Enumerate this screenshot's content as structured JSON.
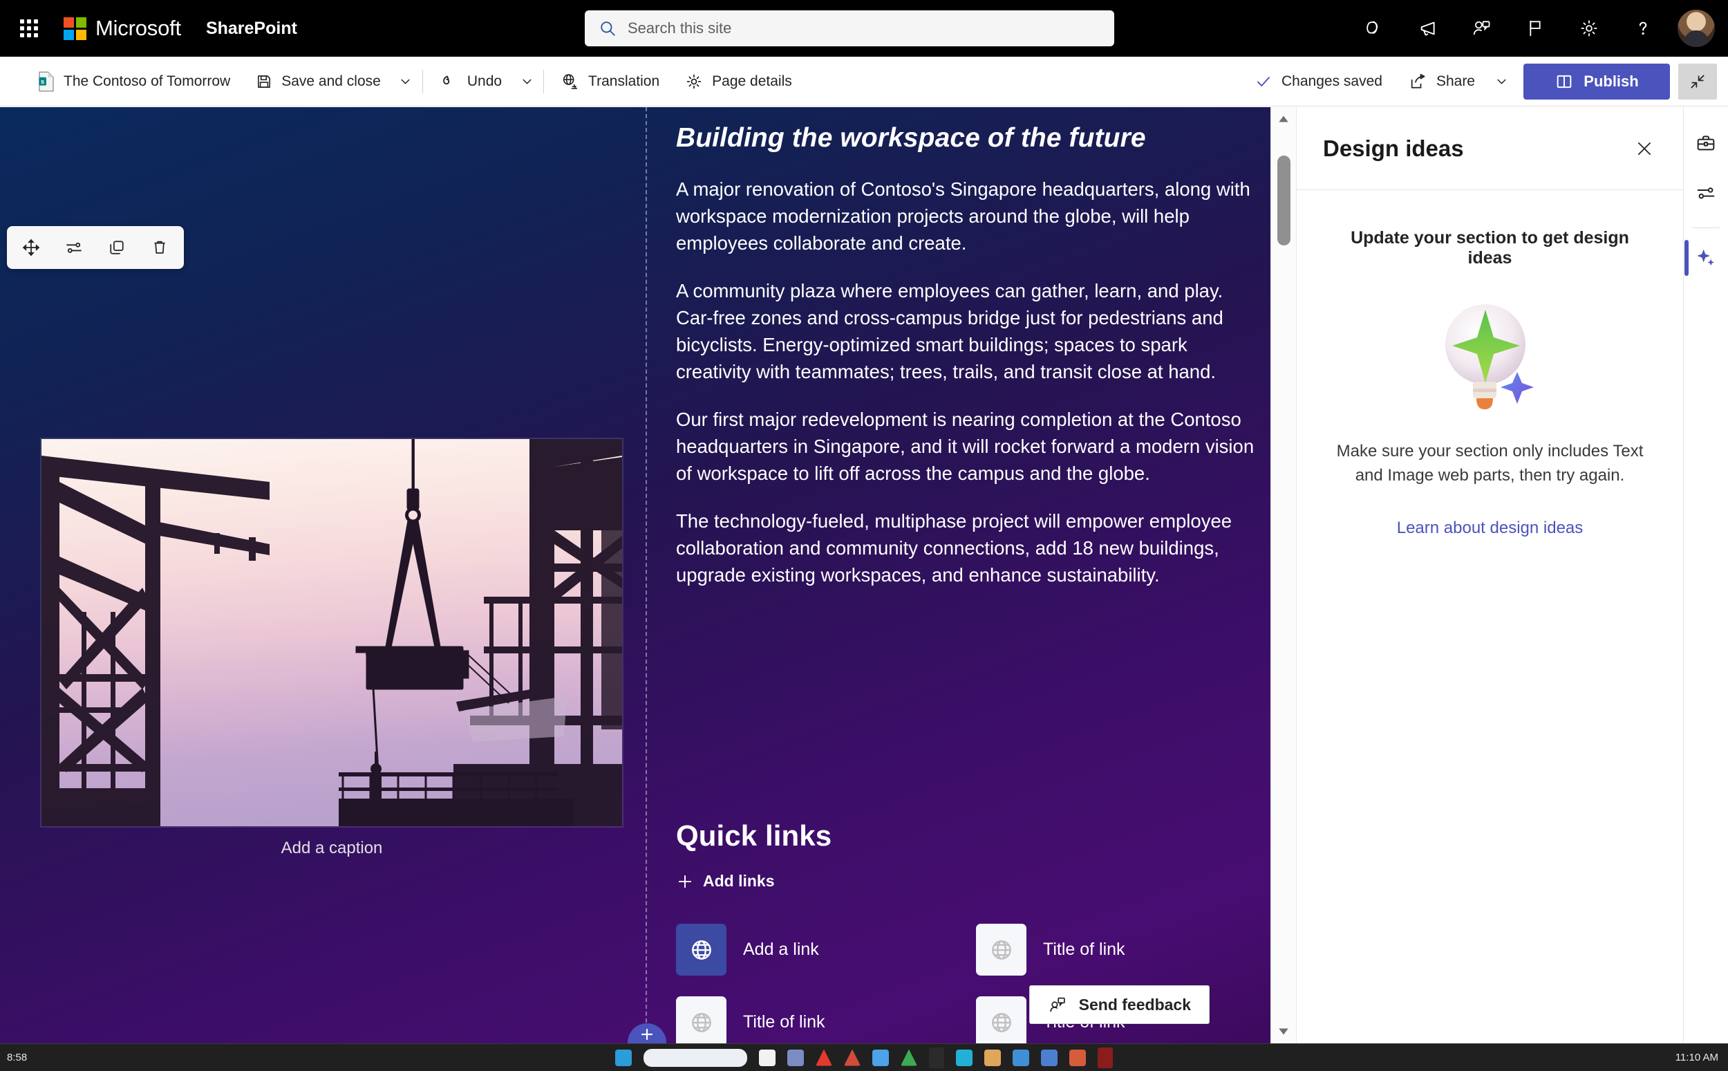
{
  "suite_header": {
    "waffle_label": "app-launcher",
    "brand": "Microsoft",
    "app_name": "SharePoint",
    "search": {
      "placeholder": "Search this site",
      "value": ""
    },
    "icons": [
      {
        "name": "copilot-icon",
        "label": "Copilot"
      },
      {
        "name": "megaphone-icon",
        "label": "What's new"
      },
      {
        "name": "meet-now-icon",
        "label": "Meet now"
      },
      {
        "name": "flag-icon",
        "label": "Focus"
      },
      {
        "name": "gear-icon",
        "label": "Settings"
      },
      {
        "name": "help-icon",
        "label": "Help"
      }
    ],
    "avatar_label": "Account manager"
  },
  "command_bar": {
    "page_name": "The Contoso of Tomorrow",
    "save_and_close": "Save and close",
    "undo": "Undo",
    "translation": "Translation",
    "page_details": "Page details",
    "status": "Changes saved",
    "share": "Share",
    "publish": "Publish",
    "collapse_label": "Collapse ribbon"
  },
  "canvas": {
    "webpart_toolbar": [
      {
        "name": "move-webpart-button",
        "label": "Move web part"
      },
      {
        "name": "edit-webpart-button",
        "label": "Edit web part"
      },
      {
        "name": "duplicate-webpart-button",
        "label": "Duplicate web part"
      },
      {
        "name": "delete-webpart-button",
        "label": "Delete web part"
      }
    ],
    "image": {
      "alt": "Construction site silhouette at dusk with crane lifting a load",
      "caption_placeholder": "Add a caption"
    },
    "text": {
      "heading": "Building the workspace of the future",
      "paragraphs": [
        "A major renovation of Contoso's Singapore headquarters, along with workspace modernization projects around the globe, will help employees collaborate and create.",
        "A community plaza where employees can gather, learn, and play. Car-free zones and cross-campus bridge just for pedestrians and bicyclists. Energy-optimized smart buildings; spaces to spark creativity with teammates; trees, trails, and transit close at hand.",
        "Our first major redevelopment is nearing completion at the Contoso headquarters in Singapore, and it will rocket forward a modern vision of workspace to lift off across the campus and the globe.",
        "The technology-fueled, multiphase project will empower employee collaboration and community connections, add 18 new buildings, upgrade existing workspaces, and enhance sustainability."
      ]
    },
    "quick_links": {
      "title": "Quick links",
      "add_links": "Add links",
      "items": [
        {
          "label": "Add a link",
          "icon": "globe-icon",
          "accent": true
        },
        {
          "label": "Title of link",
          "icon": "globe-icon",
          "accent": false
        },
        {
          "label": "Title of link",
          "icon": "globe-icon",
          "accent": false
        },
        {
          "label": "Title of link",
          "icon": "globe-icon",
          "accent": false
        }
      ]
    },
    "feedback_button": "Send feedback",
    "add_section_label": "Add a new section"
  },
  "design_panel": {
    "title": "Design ideas",
    "close_label": "Close",
    "prompt": "Update your section to get design ideas",
    "note": "Make sure your section only includes Text and Image web parts, then try again.",
    "link": "Learn about design ideas"
  },
  "right_rail": [
    {
      "name": "toolbox-icon",
      "label": "Toolbox"
    },
    {
      "name": "settings-sliders-icon",
      "label": "Web part properties"
    },
    {
      "name": "design-ideas-sparkle-icon",
      "label": "Design ideas"
    }
  ],
  "taskbar": {
    "left_clock": "8:58",
    "right_clock": "11:10 AM"
  },
  "colors": {
    "accent": "#4b53bc",
    "suite_bar": "#000000",
    "link": "#4b53bc",
    "canvas_start": "#0a2a5e",
    "canvas_end": "#480d72"
  }
}
